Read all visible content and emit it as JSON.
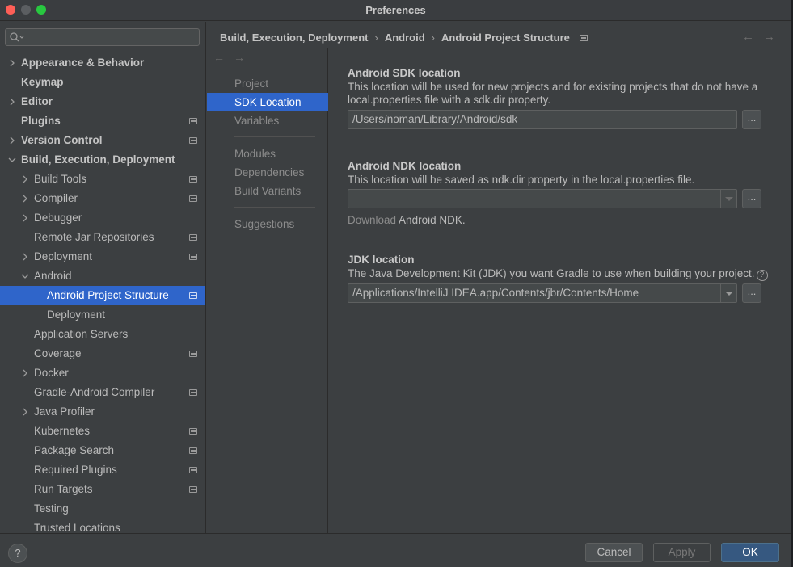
{
  "window": {
    "title": "Preferences"
  },
  "search": {
    "placeholder": ""
  },
  "tree": [
    {
      "label": "Appearance & Behavior",
      "level": 0,
      "chevron": "right",
      "bold": true,
      "badge": false
    },
    {
      "label": "Keymap",
      "level": 0,
      "chevron": "none",
      "bold": true,
      "badge": false
    },
    {
      "label": "Editor",
      "level": 0,
      "chevron": "right",
      "bold": true,
      "badge": false
    },
    {
      "label": "Plugins",
      "level": 0,
      "chevron": "none",
      "bold": true,
      "badge": true
    },
    {
      "label": "Version Control",
      "level": 0,
      "chevron": "right",
      "bold": true,
      "badge": true
    },
    {
      "label": "Build, Execution, Deployment",
      "level": 0,
      "chevron": "down",
      "bold": true,
      "badge": false
    },
    {
      "label": "Build Tools",
      "level": 1,
      "chevron": "right",
      "bold": false,
      "badge": true
    },
    {
      "label": "Compiler",
      "level": 1,
      "chevron": "right",
      "bold": false,
      "badge": true
    },
    {
      "label": "Debugger",
      "level": 1,
      "chevron": "right",
      "bold": false,
      "badge": false
    },
    {
      "label": "Remote Jar Repositories",
      "level": 1,
      "chevron": "none",
      "bold": false,
      "badge": true
    },
    {
      "label": "Deployment",
      "level": 1,
      "chevron": "right",
      "bold": false,
      "badge": true
    },
    {
      "label": "Android",
      "level": 1,
      "chevron": "down",
      "bold": false,
      "badge": false
    },
    {
      "label": "Android Project Structure",
      "level": 2,
      "chevron": "none",
      "bold": false,
      "badge": true,
      "selected": true
    },
    {
      "label": "Deployment",
      "level": 2,
      "chevron": "none",
      "bold": false,
      "badge": false
    },
    {
      "label": "Application Servers",
      "level": 1,
      "chevron": "none",
      "bold": false,
      "badge": false
    },
    {
      "label": "Coverage",
      "level": 1,
      "chevron": "none",
      "bold": false,
      "badge": true
    },
    {
      "label": "Docker",
      "level": 1,
      "chevron": "right",
      "bold": false,
      "badge": false
    },
    {
      "label": "Gradle-Android Compiler",
      "level": 1,
      "chevron": "none",
      "bold": false,
      "badge": true
    },
    {
      "label": "Java Profiler",
      "level": 1,
      "chevron": "right",
      "bold": false,
      "badge": false
    },
    {
      "label": "Kubernetes",
      "level": 1,
      "chevron": "none",
      "bold": false,
      "badge": true
    },
    {
      "label": "Package Search",
      "level": 1,
      "chevron": "none",
      "bold": false,
      "badge": true
    },
    {
      "label": "Required Plugins",
      "level": 1,
      "chevron": "none",
      "bold": false,
      "badge": true
    },
    {
      "label": "Run Targets",
      "level": 1,
      "chevron": "none",
      "bold": false,
      "badge": true
    },
    {
      "label": "Testing",
      "level": 1,
      "chevron": "none",
      "bold": false,
      "badge": false
    },
    {
      "label": "Trusted Locations",
      "level": 1,
      "chevron": "none",
      "bold": false,
      "badge": false
    }
  ],
  "breadcrumb": {
    "items": [
      "Build, Execution, Deployment",
      "Android",
      "Android Project Structure"
    ],
    "separator": "›"
  },
  "nav": {
    "back": "←",
    "forward": "→",
    "items": [
      "Project",
      "SDK Location",
      "Variables",
      "Modules",
      "Dependencies",
      "Build Variants",
      "Suggestions"
    ],
    "active": "SDK Location"
  },
  "sdk": {
    "title": "Android SDK location",
    "desc": "This location will be used for new projects and for existing projects that do not have a local.properties file with a sdk.dir property.",
    "value": "/Users/noman/Library/Android/sdk",
    "browse": "..."
  },
  "ndk": {
    "title": "Android NDK location",
    "desc": "This location will be saved as ndk.dir property in the local.properties file.",
    "value": "",
    "browse": "...",
    "download_link": "Download",
    "download_suffix": " Android NDK."
  },
  "jdk": {
    "title": "JDK location",
    "desc": "The Java Development Kit (JDK) you want Gradle to use when building your project.",
    "help": "?",
    "value": "/Applications/IntelliJ IDEA.app/Contents/jbr/Contents/Home",
    "browse": "..."
  },
  "footer": {
    "help": "?",
    "cancel": "Cancel",
    "apply": "Apply",
    "ok": "OK"
  },
  "colors": {
    "selection": "#2f65ca",
    "ok_button": "#365880",
    "background": "#3c3f41"
  }
}
